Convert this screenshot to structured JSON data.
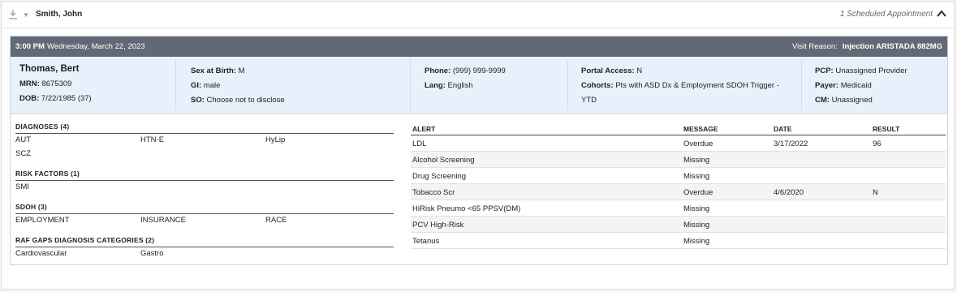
{
  "header": {
    "owner": "Smith, John",
    "scheduled": "1 Scheduled Appointment"
  },
  "appointment": {
    "time": "3:00 PM",
    "date": "Wednesday, March 22, 2023",
    "visit_reason_label": "Visit Reason:",
    "visit_reason_value": "Injection ARISTADA 882MG"
  },
  "patient": {
    "name": "Thomas, Bert",
    "mrn_label": "MRN:",
    "mrn": "8675309",
    "dob_label": "DOB:",
    "dob": "7/22/1985 (37)",
    "sex_label": "Sex at Birth:",
    "sex": "M",
    "gi_label": "GI:",
    "gi": "male",
    "so_label": "SO:",
    "so": "Choose not to disclose",
    "phone_label": "Phone:",
    "phone": "(999) 999-9999",
    "lang_label": "Lang:",
    "lang": "English",
    "portal_label": "Portal Access:",
    "portal": "N",
    "cohorts_label": "Cohorts:",
    "cohorts_line1": "Pts with ASD Dx & Employment SDOH Trigger -",
    "cohorts_line2": "YTD",
    "pcp_label": "PCP:",
    "pcp": "Unassigned Provider",
    "payer_label": "Payer:",
    "payer": "Medicaid",
    "cm_label": "CM:",
    "cm": "Unassigned"
  },
  "diagnoses": {
    "title": "DIAGNOSES (4)",
    "items": [
      "AUT",
      "HTN-E",
      "HyLip",
      "SCZ"
    ]
  },
  "risk_factors": {
    "title": "RISK FACTORS (1)",
    "items": [
      "SMI"
    ]
  },
  "sdoh": {
    "title": "SDOH (3)",
    "items": [
      "EMPLOYMENT",
      "INSURANCE",
      "RACE"
    ]
  },
  "raf_gaps": {
    "title": "RAF GAPS DIAGNOSIS CATEGORIES (2)",
    "items": [
      "Cardiovascular",
      "Gastro"
    ]
  },
  "alerts": {
    "columns": [
      "ALERT",
      "MESSAGE",
      "DATE",
      "RESULT"
    ],
    "rows": [
      {
        "alert": "LDL",
        "message": "Overdue",
        "date": "3/17/2022",
        "result": "96"
      },
      {
        "alert": "Alcohol Screening",
        "message": "Missing",
        "date": "",
        "result": ""
      },
      {
        "alert": "Drug Screening",
        "message": "Missing",
        "date": "",
        "result": ""
      },
      {
        "alert": "Tobacco Scr",
        "message": "Overdue",
        "date": "4/6/2020",
        "result": "N"
      },
      {
        "alert": "HiRisk Pneumo <65 PPSV(DM)",
        "message": "Missing",
        "date": "",
        "result": ""
      },
      {
        "alert": "PCV High-Risk",
        "message": "Missing",
        "date": "",
        "result": ""
      },
      {
        "alert": "Tetanus",
        "message": "Missing",
        "date": "",
        "result": ""
      }
    ]
  },
  "colors": {
    "appt_bar": "#616a74",
    "patient_strip": "#e8f1fb"
  },
  "icons": [
    "download-icon",
    "caret-down-icon",
    "chevron-up-icon"
  ]
}
